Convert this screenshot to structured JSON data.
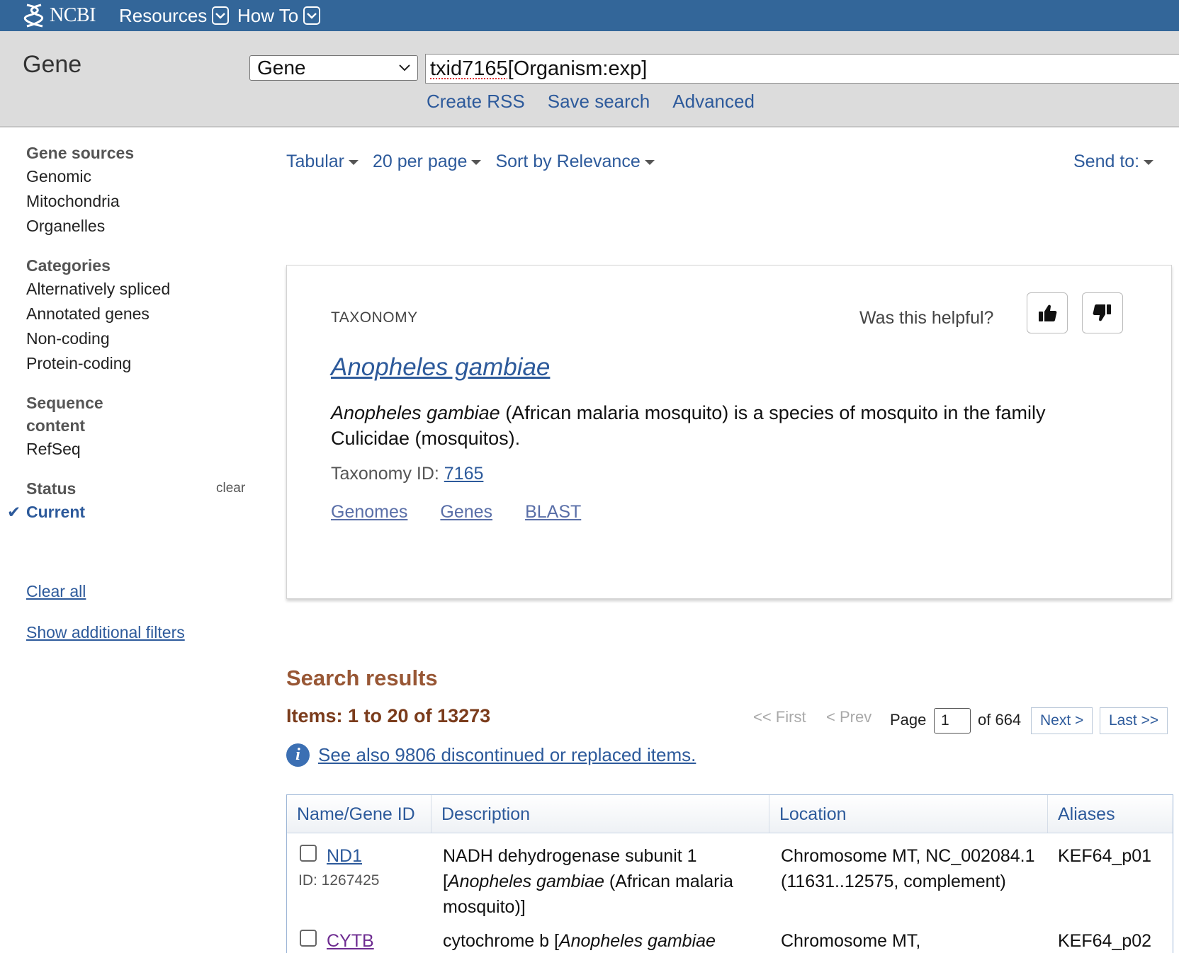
{
  "topbar": {
    "logo_text": "NCBI",
    "resources_label": "Resources",
    "howto_label": "How To"
  },
  "search": {
    "db_title": "Gene",
    "db_selected": "Gene",
    "term_misspelled": "txid7165",
    "term_rest": "[Organism:exp]",
    "links": [
      "Create RSS",
      "Save search",
      "Advanced"
    ]
  },
  "sidebar": {
    "groups": [
      {
        "heading": "Gene sources",
        "items": [
          "Genomic",
          "Mitochondria",
          "Organelles"
        ]
      },
      {
        "heading": "Categories",
        "items": [
          "Alternatively spliced",
          "Annotated genes",
          "Non-coding",
          "Protein-coding"
        ]
      },
      {
        "heading": "Sequence content",
        "items": [
          "RefSeq"
        ]
      }
    ],
    "status_heading": "Status",
    "status_clear": "clear",
    "status_current": "Current",
    "clear_all": "Clear all",
    "show_filters": "Show additional filters"
  },
  "display": {
    "format": "Tabular",
    "per_page": "20 per page",
    "sort": "Sort by Relevance",
    "send_to": "Send to:"
  },
  "taxonomy_card": {
    "label": "TAXONOMY",
    "helpful": "Was this helpful?",
    "title": "Anopheles gambiae",
    "desc_species": "Anopheles gambiae",
    "desc_rest": " (African malaria mosquito) is a species of mosquito in the family Culicidae (mosquitos).",
    "taxid_label": "Taxonomy ID: ",
    "taxid": "7165",
    "links": [
      "Genomes",
      "Genes",
      "BLAST"
    ]
  },
  "results": {
    "title": "Search results",
    "items": "Items: 1 to 20 of 13273",
    "first": "<< First",
    "prev": "< Prev",
    "page_label": "Page",
    "page_value": "1",
    "of_pages": "of 664",
    "next": "Next >",
    "last": "Last >>",
    "see_also": "See also 9806 discontinued or replaced items."
  },
  "table": {
    "headers": [
      "Name/Gene ID",
      "Description",
      "Location",
      "Aliases"
    ],
    "rows": [
      {
        "name": "ND1",
        "id": "ID: 1267425",
        "desc_pre": "NADH dehydrogenase subunit 1 [",
        "desc_species": "Anopheles gambiae",
        "desc_post": " (African malaria mosquito)]",
        "location": "Chromosome MT, NC_002084.1 (11631..12575, complement)",
        "aliases": "KEF64_p01"
      },
      {
        "name": "CYTB",
        "desc_pre": "cytochrome b [",
        "desc_species": "Anopheles gambiae",
        "location": "Chromosome MT,",
        "aliases": "KEF64_p02"
      }
    ]
  },
  "colors": {
    "topbar": "#336699",
    "search_band": "#dcdcdc",
    "link": "#2d5a9b",
    "results_title": "#985735",
    "items_count": "#7b3c1c"
  },
  "icons": [
    "ncbi-helix-icon",
    "chevron-down-icon",
    "thumbs-up-icon",
    "thumbs-down-icon",
    "checkmark-icon",
    "info-icon",
    "caret-down-icon"
  ]
}
